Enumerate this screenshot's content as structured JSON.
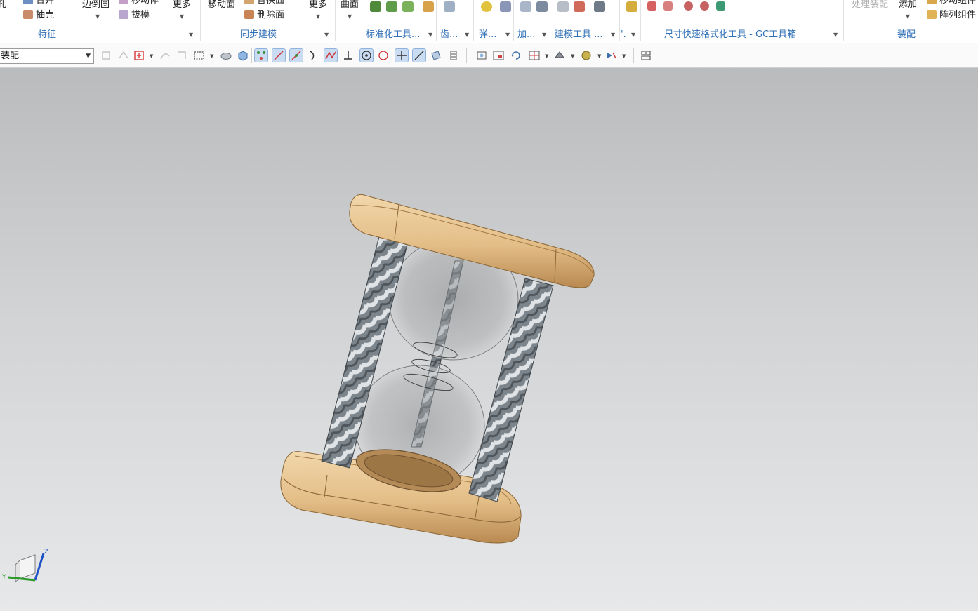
{
  "ribbon": {
    "feature": {
      "hole": "孔",
      "merge": "合并",
      "shell": "抽壳",
      "edge_blend": "边倒圆",
      "offset": "移动体",
      "draft": "拔模",
      "more": "更多",
      "group_label": "特征"
    },
    "sync": {
      "move_face": "移动面",
      "replace_face": "替换面",
      "delete_face": "删除面",
      "more": "更多",
      "group_label": "同步建模"
    },
    "surface": {
      "label": "曲面"
    },
    "groups": {
      "standard_tools": "标准化工具...",
      "gear": "齿...",
      "spring": "弹...",
      "add": "加...",
      "modeling_tools": "建模工具 ...",
      "dim": "'.",
      "gc_toolbox": "尺寸快速格式化工具 - GC工具箱",
      "assembly": "装配"
    },
    "assembly": {
      "process_assembly": "处理装配",
      "add": "添加",
      "move_component": "移动组件",
      "array_component": "阵列组件"
    }
  },
  "toolbar": {
    "filter_value": "装配"
  },
  "triad": {
    "z": "Z",
    "y": "Y"
  },
  "colors": {
    "accent": "#2e6fb6",
    "wood": "#e6c38e",
    "metal": "#9aa2a8"
  }
}
